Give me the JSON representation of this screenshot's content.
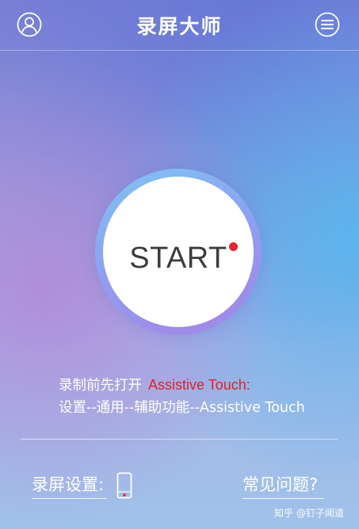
{
  "header": {
    "title": "录屏大师",
    "profile_icon": "user-icon",
    "menu_icon": "menu-icon"
  },
  "start_button": {
    "label": "START",
    "indicator_icon": "record-dot-icon",
    "indicator_color": "#e8242c"
  },
  "instructions": {
    "line1_prefix": "录制前先打开",
    "line1_highlight": "Assistive Touch:",
    "line2": "设置--通用--辅助功能--Assistive Touch",
    "highlight_color": "#e3202a"
  },
  "footer": {
    "settings_label": "录屏设置:",
    "settings_icon": "phone-icon",
    "faq_label": "常见问题?"
  },
  "watermark": "知乎 @钉子闻道"
}
